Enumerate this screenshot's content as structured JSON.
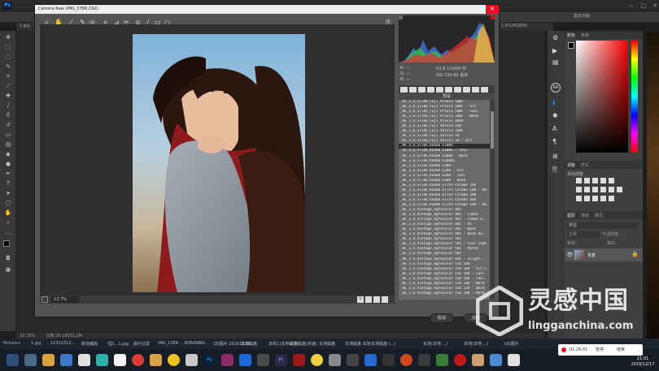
{
  "ps": {
    "logo": "Ps",
    "workspace": "基本功能",
    "doc_tab_left": "1.jpg",
    "doc_tab_right": "1.8%(RGB/8)",
    "status": "33.78%",
    "status_doc": "文档:35.1M/31.2M"
  },
  "camera_raw": {
    "title": "Camera Raw (IMG_0788.CR2)",
    "zoom": "13.7%",
    "camera_info_line1": "f/1.8  1/1000 秒",
    "camera_info_line2": "ISO 100  85 毫米",
    "rgb_r": "R: ---",
    "rgb_g": "G: ---",
    "rgb_b": "B: ---",
    "presets_header": "预设",
    "presets": [
      "_RE_3_O_Slide_Fuji Provia 100F",
      "_RE_3_O_Slide_Fuji Provia 100F - Alt",
      "_RE_3_O_Slide_Fuji Provia 100F - Cool",
      "_RE_3_O_Slide_Fuji Provia 100F - Warm",
      "_RE_3_O_Slide_Fuji Provia 400X",
      "_RE_3_O_Slide_Fuji Velvia 100",
      "_RE_3_O_Slide_Fuji Velvia 100F",
      "_RE_3_O_Slide_Fuji Velvia 50",
      "_RE_3_O_Slide_Fuji Velvia 50 - Alt",
      "_RE_3_O_Slide_Kodak E100G",
      "_RE_3_O_Slide_Kodak E100G - Cool",
      "_RE_3_O_Slide_Kodak E100G - Warm",
      "_RE_3_O_Slide_Kodak E100VS",
      "_RE_3_O_Slide_Kodak E200",
      "_RE_3_O_Slide_Kodak E200 - Alt",
      "_RE_3_O_Slide_Kodak E200 - Cool",
      "_RE_3_O_Slide_Kodak E200 - Warm",
      "_RE_3_O_Slide_Kodak Elite Chrome 100",
      "_RE_3_O_Slide_Kodak Elite Chrome 100 - Wa",
      "_RE_3_O_Slide_Kodak Elite Chrome 200",
      "_RE_3_O_Slide_Kodak Elite Chrome 400",
      "_RE_3_O_Slide_Kodak Elite Chrome 100 - Wa",
      "_RE_3_O_Vintage_Agfacolor 40s",
      "_RE_3_O_Vintage_Agfacolor 40s - Faded",
      "_RE_3_O_Vintage_Agfacolor 40s - Faded B..",
      "_RE_3_O_Vintage_Agfacolor 40s - HC",
      "_RE_3_O_Vintage_Agfacolor 40s - Warm",
      "_RE_3_O_Vintage_Agfacolor 40s - Warm Ba..",
      "_RE_3_O_Vintage_Agfacolor 50s",
      "_RE_3_O_Vintage_Agfacolor 50s - Cool Fade",
      "_RE_3_O_Vintage_Agfacolor 50s - Muted",
      "_RE_3_O_Vintage_Agfacolor 60s",
      "_RE_3_O_Vintage_Agfacolor 60s - Slight..",
      "_RE_3_O_Vintage_Agfacolor ISO 100",
      "_RE_3_O_Vintage_Agfacolor ISO 100 - Alt C",
      "_RE_3_O_Vintage_Agfacolor ISO 100 - Cool",
      "_RE_3_O_Vintage_Agfacolor ISO 100 - Fad..",
      "_RE_3_O_Vintage_Agfacolor ISO 100 - Warm",
      "_RE_3_O_Vintage_Agfacolor ISO 100 - Warm",
      "_RE_3_O_Vintage_Agfacolor ISO 100 - Warm"
    ],
    "cancel_label": "取消",
    "done_label": "完成"
  },
  "panels": {
    "color_tab": "颜色",
    "swatches_tab": "色板",
    "adjust_tab": "调整",
    "styles_tab": "样式",
    "adjust_add": "添加调整",
    "layers_tab": "图层",
    "channels_tab": "通道",
    "paths_tab": "路径",
    "kind_label": "类型",
    "normal_label": "正常",
    "opacity_label": "不透明度:",
    "lock_label": "锁定:",
    "fill_label": "填充:",
    "layer_name": "背景"
  },
  "taskbar": {
    "top_labels": [
      "Picture+",
      "1.jpg",
      "12312312...",
      "新增编辑",
      "f型(...1.jpg",
      "图片钉屏",
      "IMG_1364...",
      "3D8A9882...",
      "QQ图片 20161218...",
      "本地磁盘",
      "本机C(本地磁盘)",
      "本地磁盘(快速)",
      "本地磁盘",
      "本地磁盘 本地",
      "本地磁盘 (...)",
      "本地(本地 ...)",
      "本地(本地 ...)",
      "QQ图片"
    ],
    "rec_time": "01:26:01",
    "rec_pause": "暂停",
    "rec_stop": "结束",
    "time": "21:01",
    "date": "2016/12/17"
  },
  "watermark": {
    "cn": "灵感中国",
    "en": "lingganchina.com"
  }
}
